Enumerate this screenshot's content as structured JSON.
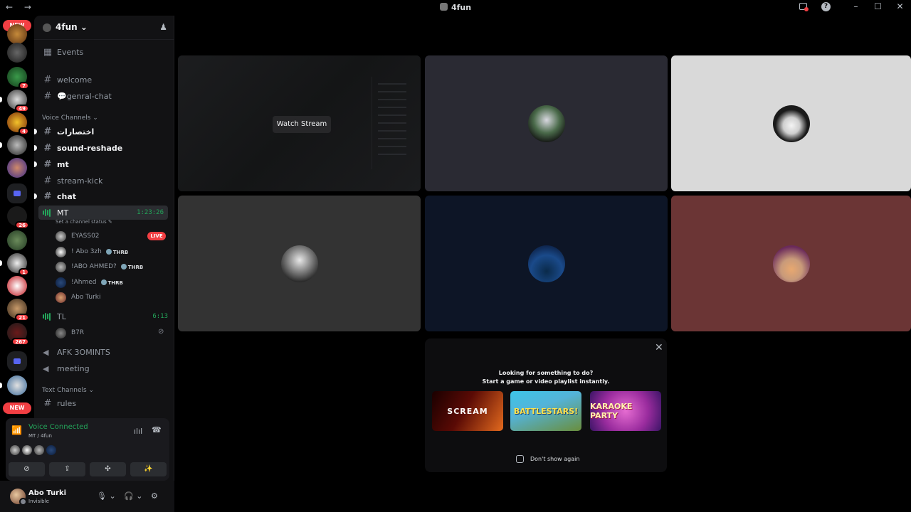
{
  "window": {
    "title": "4fun",
    "nav": "← →",
    "buttons": {
      "minimize": "–",
      "maximize": "☐",
      "close": "✕"
    },
    "help": "?"
  },
  "rail": {
    "new_top": "NEW",
    "new_bottom": "NEW",
    "badges": [
      "7",
      "49",
      "4",
      "26",
      "1",
      "21",
      "267"
    ]
  },
  "server": {
    "name": "4fun ⌄",
    "add_icon": "♟"
  },
  "channels": {
    "events": "Events",
    "welcome": "welcome",
    "genral": "💬genral-chat",
    "voice_category": "Voice Channels ⌄",
    "arabic": "اختصارات",
    "sound": "sound-reshade",
    "mt_text": "mt",
    "stream_kick": "stream-kick",
    "chat": "chat",
    "voice_mt": {
      "name": "MT",
      "timer": "1:23:26",
      "status": "Set a channel status ✎"
    },
    "members": [
      {
        "name": "EYASS02",
        "live": "LIVE"
      },
      {
        "name": "! Abo 3zh",
        "tag": "THRB"
      },
      {
        "name": "!ABO AHMED?",
        "tag": "THRB"
      },
      {
        "name": "!Ahmed",
        "tag": "THRB"
      },
      {
        "name": "Abo Turki"
      }
    ],
    "voice_tl": {
      "name": "TL",
      "timer": "6:13"
    },
    "tl_member": {
      "name": "B7R",
      "muted_icon": "⊘"
    },
    "afk": "AFK 3OMINTS",
    "meeting": "meeting",
    "text_category": "Text Channels ⌄",
    "rules": "rules"
  },
  "voice_panel": {
    "title": "Voice Connected",
    "sub": "MT / 4fun",
    "buttons": [
      "⊘",
      "⇪",
      "✣",
      "✨"
    ],
    "wave": "ılıl",
    "hangup": "☎"
  },
  "user": {
    "name": "Abo Turki",
    "status": "Invisible",
    "mic": "🎙 ⌄",
    "headset": "🎧 ⌄",
    "settings": "⚙"
  },
  "stage": {
    "watch_label": "Watch Stream",
    "tile_colors": [
      "#2a2a33",
      "#d9d9d9",
      "#333333",
      "#0d1526",
      "#6b3535"
    ]
  },
  "activity": {
    "close": "✕",
    "line1": "Looking for something to do?",
    "line2": "Start a game or video playlist instantly.",
    "games": [
      "SCREAM",
      "BATTLESTARS!",
      "KARAOKE PARTY"
    ],
    "dont_show": "Don't show again"
  }
}
